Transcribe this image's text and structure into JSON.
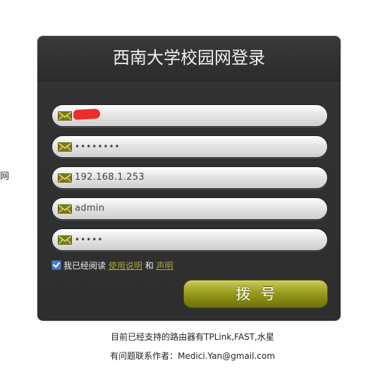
{
  "side_text": "网",
  "login": {
    "title": "西南大学校园网登录",
    "fields": [
      {
        "name": "username-field",
        "value": "",
        "redacted": true
      },
      {
        "name": "password-field",
        "value": "••••••••"
      },
      {
        "name": "router-ip-field",
        "value": "192.168.1.253"
      },
      {
        "name": "router-user-field",
        "value": "admin"
      },
      {
        "name": "router-password-field",
        "value": "•••••"
      }
    ],
    "agree": {
      "checked": true,
      "prefix": "我已经阅读",
      "link1": "使用说明",
      "and": "和",
      "link2": "声明"
    },
    "dial_button": "拨号"
  },
  "footer": {
    "routers": "目前已经支持的路由器有TPLink,FAST,水星",
    "contact": "有问题联系作者：Medici.Yan@gmail.com"
  },
  "colors": {
    "panel": "#2e2e2e",
    "accent_olive": "#8b8d16",
    "link": "#a6a83a",
    "redaction": "#ea2d2d"
  },
  "icons": {
    "field_icon": "envelope-icon"
  }
}
